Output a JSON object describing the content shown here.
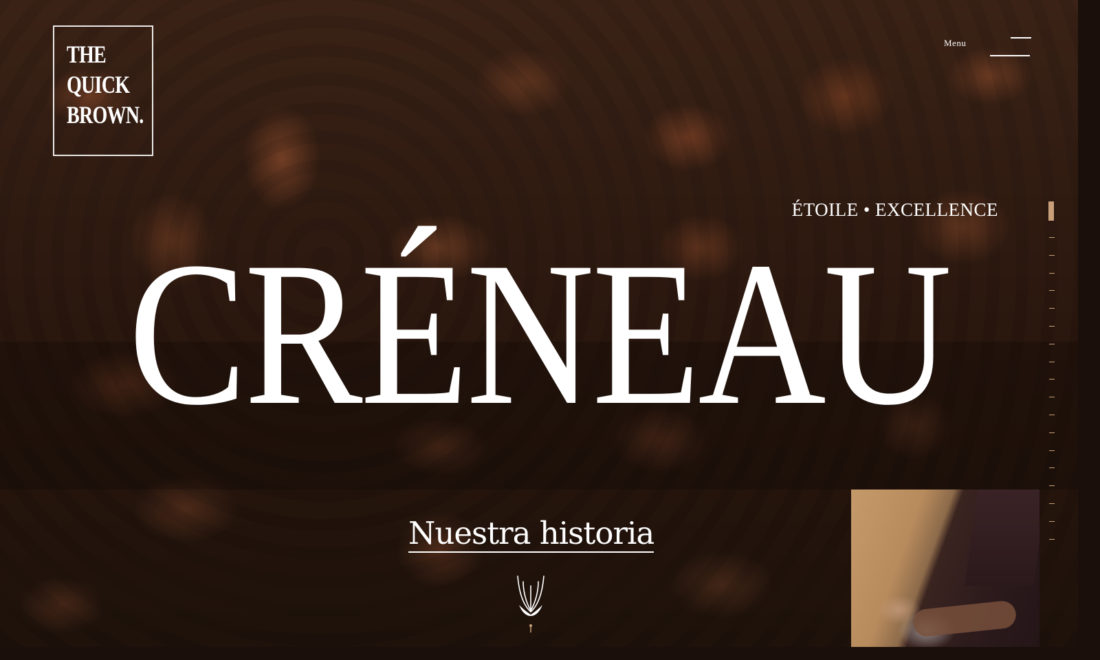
{
  "logo": {
    "lines": [
      "THE",
      "QUICK",
      "BROWN."
    ]
  },
  "header": {
    "menu_label": "Menu",
    "menu_icon": "hamburger-menu-icon"
  },
  "hero": {
    "tagline": "ÉTOILE • EXCELLENCE",
    "title": "CRÉNEAU",
    "cta_label": "Nuestra historia",
    "emblem_icon": "leaf-emblem-icon"
  },
  "side_rail": {
    "tick_count": 18,
    "active_index": 0,
    "accent_color": "#c9a07a"
  },
  "colors": {
    "text": "#ffffff",
    "accent": "#c9a07a",
    "background": "#2a170e"
  }
}
